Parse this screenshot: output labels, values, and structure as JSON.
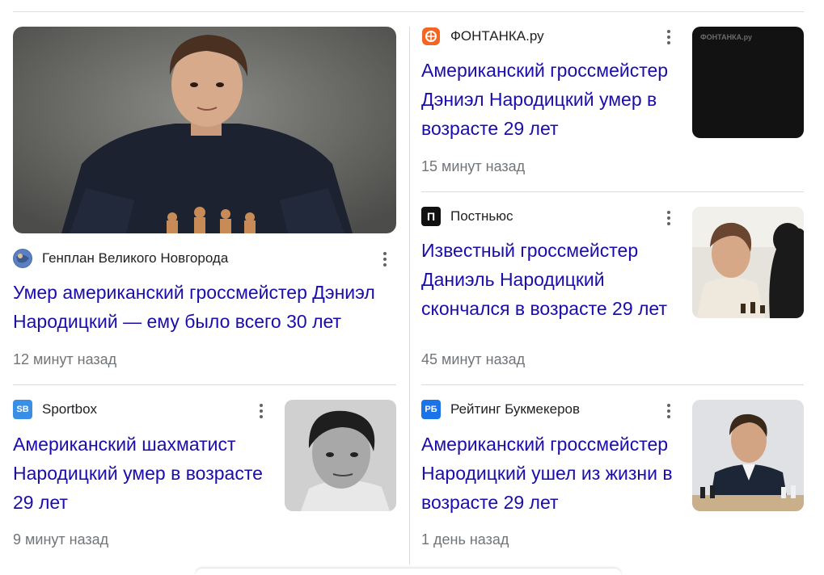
{
  "articles": [
    {
      "source": "Генплан Великого Новгорода",
      "headline": "Умер американский гроссмейстер Дэниэл Народицкий — ему было всего 30 лет",
      "time": "12 минут назад",
      "logo_icon": "globe-icon"
    },
    {
      "source": "ФОНТАНКА.ру",
      "headline": "Американский гроссмейстер Дэниэл Народицкий умер в возрасте 29 лет",
      "time": "15 минут назад",
      "logo_icon": "fontanka-logo",
      "thumb_text": "ФОНТАНКА.ру"
    },
    {
      "source": "Постньюс",
      "headline": "Известный гроссмейстер Даниэль Народицкий скончался в возрасте 29 лет",
      "time": "45 минут назад",
      "logo_icon": "postnews-logo",
      "logo_letter": "П"
    },
    {
      "source": "Sportbox",
      "headline": "Американский шахматист Народицкий умер в возрасте 29 лет",
      "time": "9 минут назад",
      "logo_icon": "sportbox-logo",
      "logo_letter": "SB"
    },
    {
      "source": "Рейтинг Букмекеров",
      "headline": "Американский гроссмейстер Народицкий ушел из жизни в возрасте 29 лет",
      "time": "1 день назад",
      "logo_icon": "rb-logo",
      "logo_letter": "РБ"
    }
  ],
  "colors": {
    "headline": "#1a0dab",
    "meta": "#70757a",
    "divider": "#dadce0",
    "fontanka": "#f26522",
    "sportbox": "#3a8ee6",
    "rb": "#1a73e8"
  }
}
